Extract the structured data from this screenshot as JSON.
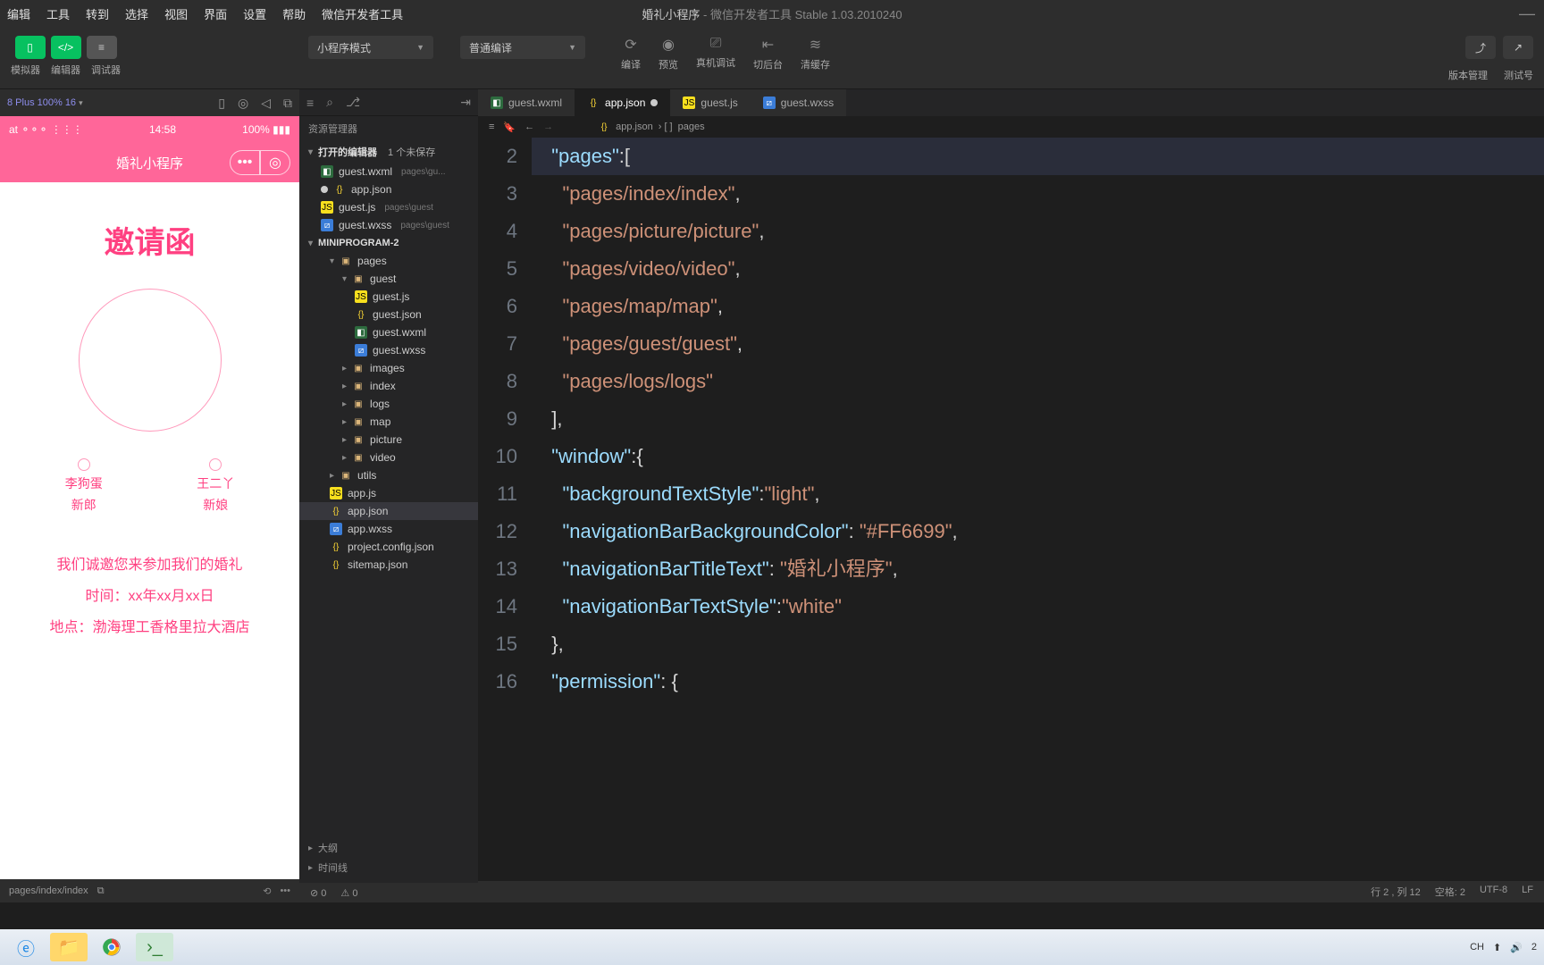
{
  "menu": [
    "编辑",
    "工具",
    "转到",
    "选择",
    "视图",
    "界面",
    "设置",
    "帮助",
    "微信开发者工具"
  ],
  "title": {
    "project": "婚礼小程序",
    "suffix": " - 微信开发者工具 Stable 1.03.2010240"
  },
  "toolbar": {
    "labels": {
      "simulator": "模拟器",
      "editor": "编辑器",
      "debugger": "调试器"
    },
    "mode": "小程序模式",
    "compile": "普通编译",
    "actions": {
      "compile": "编译",
      "preview": "预览",
      "remote": "真机调试",
      "background": "切后台",
      "cache": "清缓存"
    },
    "right": {
      "version": "版本管理",
      "test": "测试号"
    }
  },
  "simulator": {
    "device": "8 Plus 100% 16",
    "carrier": "at",
    "time": "14:58",
    "battery": "100%",
    "navTitle": "婚礼小程序",
    "invite": {
      "title": "邀请函",
      "groom": "李狗蛋",
      "groomRole": "新郎",
      "bride": "王二丫",
      "brideRole": "新娘",
      "line1": "我们诚邀您来参加我们的婚礼",
      "line2": "时间：xx年xx月xx日",
      "line3": "地点：渤海理工香格里拉大酒店"
    },
    "statusPath": "pages/index/index"
  },
  "explorer": {
    "header": "资源管理器",
    "section1": "打开的编辑器",
    "section1Badge": "1 个未保存",
    "openFiles": [
      {
        "name": "guest.wxml",
        "path": "pages\\gu...",
        "icon": "wxml"
      },
      {
        "name": "app.json",
        "path": "",
        "icon": "json",
        "unsaved": true
      },
      {
        "name": "guest.js",
        "path": "pages\\guest",
        "icon": "js"
      },
      {
        "name": "guest.wxss",
        "path": "pages\\guest",
        "icon": "wxss"
      }
    ],
    "project": "MINIPROGRAM-2",
    "tree": {
      "pages": "pages",
      "guest": "guest",
      "guestFiles": [
        "guest.js",
        "guest.json",
        "guest.wxml",
        "guest.wxss"
      ],
      "folders": [
        "images",
        "index",
        "logs",
        "map",
        "picture",
        "video",
        "utils"
      ],
      "rootFiles": [
        {
          "name": "app.js",
          "icon": "js"
        },
        {
          "name": "app.json",
          "icon": "json",
          "selected": true
        },
        {
          "name": "app.wxss",
          "icon": "wxss"
        },
        {
          "name": "project.config.json",
          "icon": "json"
        },
        {
          "name": "sitemap.json",
          "icon": "json"
        }
      ]
    },
    "bottom": {
      "outline": "大纲",
      "timeline": "时间线"
    }
  },
  "tabs": [
    {
      "name": "guest.wxml",
      "icon": "wxml"
    },
    {
      "name": "app.json",
      "icon": "json",
      "active": true,
      "dirty": true
    },
    {
      "name": "guest.js",
      "icon": "js"
    },
    {
      "name": "guest.wxss",
      "icon": "wxss"
    }
  ],
  "breadcrumb": {
    "file": "app.json",
    "path": "pages"
  },
  "code": {
    "lines": [
      2,
      3,
      4,
      5,
      6,
      7,
      8,
      9,
      10,
      11,
      12,
      13,
      14,
      15,
      16
    ],
    "l2a": "\"pages\"",
    "l2b": ":[",
    "pages": [
      "\"pages/index/index\"",
      "\"pages/picture/picture\"",
      "\"pages/video/video\"",
      "\"pages/map/map\"",
      "\"pages/guest/guest\"",
      "\"pages/logs/logs\""
    ],
    "l9": "],",
    "l10a": "\"window\"",
    "l10b": ":{",
    "win": [
      {
        "k": "\"backgroundTextStyle\"",
        "sep": ":",
        "v": "\"light\"",
        "end": ","
      },
      {
        "k": "\"navigationBarBackgroundColor\"",
        "sep": ": ",
        "v": "\"#FF6699\"",
        "end": ","
      },
      {
        "k": "\"navigationBarTitleText\"",
        "sep": ": ",
        "v": "\"婚礼小程序\"",
        "end": ","
      },
      {
        "k": "\"navigationBarTextStyle\"",
        "sep": ":",
        "v": "\"white\"",
        "end": ""
      }
    ],
    "l15": "},",
    "l16a": "\"permission\"",
    "l16b": ": {"
  },
  "simStatus": {
    "problems": "0",
    "warnings": "0"
  },
  "status": {
    "pos": "行 2 , 列 12",
    "spaces": "空格: 2",
    "enc": "UTF-8",
    "eol": "LF"
  },
  "taskbar": {
    "ime": "CH",
    "time": "2"
  }
}
